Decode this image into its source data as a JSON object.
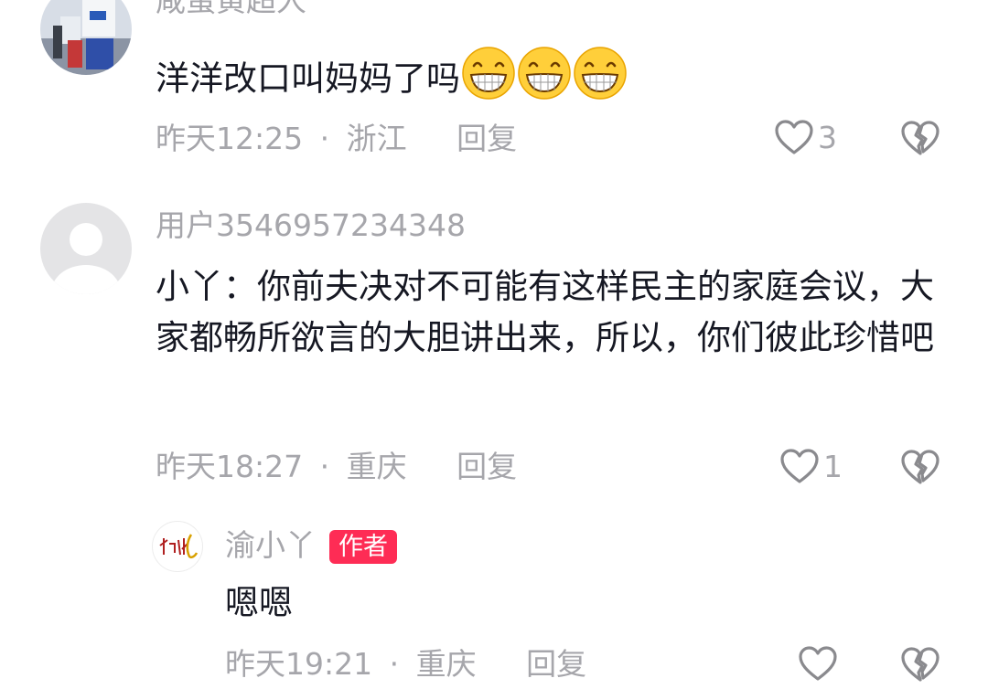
{
  "comments": [
    {
      "username": "咸蛋黄超人",
      "text": "洋洋改口叫妈妈了吗",
      "emoji_count": 3,
      "emoji_icon": "grinning-face-icon",
      "time": "昨天12:25",
      "location": "浙江",
      "reply_label": "回复",
      "likes": "3"
    },
    {
      "username": "用户3546957234348",
      "text": "小丫：你前夫决对不可能有这样民主的家庭会议，大家都畅所欲言的大胆讲出来，所以，你们彼此珍惜吧",
      "time": "昨天18:27",
      "location": "重庆",
      "reply_label": "回复",
      "likes": "1"
    }
  ],
  "reply": {
    "username": "渝小丫",
    "badge": "作者",
    "text": "嗯嗯",
    "time": "昨天19:21",
    "location": "重庆",
    "reply_label": "回复",
    "likes": ""
  },
  "separator": "·",
  "colors": {
    "text": "#161823",
    "meta": "#a6a6ab",
    "badge": "#fe2c55",
    "icon": "#8a8a8e"
  }
}
